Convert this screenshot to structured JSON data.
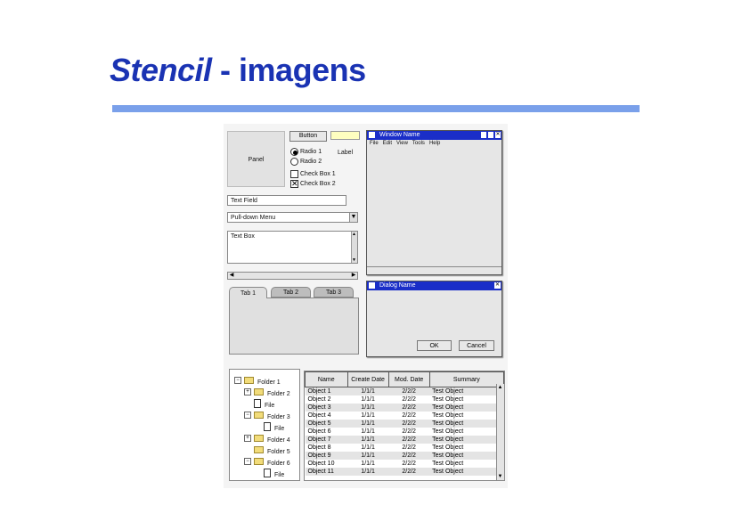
{
  "title": {
    "italic": "Stencil",
    "rest": " - imagens"
  },
  "panel": {
    "label": "Panel"
  },
  "button": {
    "label": "Button"
  },
  "radios": [
    {
      "label": "Radio 1",
      "checked": true
    },
    {
      "label": "Radio 2",
      "checked": false
    }
  ],
  "label_text": "Label",
  "checkboxes": [
    {
      "label": "Check Box 1",
      "checked": false
    },
    {
      "label": "Check Box 2",
      "checked": true
    }
  ],
  "text_field": "Text Field",
  "pulldown": "Pull-down Menu",
  "text_box": "Text Box",
  "tabs": [
    "Tab 1",
    "Tab 2",
    "Tab 3"
  ],
  "window": {
    "title": "Window Name",
    "menu": [
      "File",
      "Edit",
      "View",
      "Tools",
      "Help"
    ]
  },
  "dialog": {
    "title": "Dialog Name",
    "ok": "OK",
    "cancel": "Cancel"
  },
  "tree": [
    "Folder 1",
    "Folder 2",
    "File",
    "Folder 3",
    "File",
    "Folder 4",
    "Folder 5",
    "Folder 6",
    "File"
  ],
  "table": {
    "columns": [
      "Name",
      "Create Date",
      "Mod. Date",
      "Summary"
    ],
    "rows": [
      [
        "Object 1",
        "1/1/1",
        "2/2/2",
        "Test Object"
      ],
      [
        "Object 2",
        "1/1/1",
        "2/2/2",
        "Test Object"
      ],
      [
        "Object 3",
        "1/1/1",
        "2/2/2",
        "Test Object"
      ],
      [
        "Object 4",
        "1/1/1",
        "2/2/2",
        "Test Object"
      ],
      [
        "Object 5",
        "1/1/1",
        "2/2/2",
        "Test Object"
      ],
      [
        "Object 6",
        "1/1/1",
        "2/2/2",
        "Test Object"
      ],
      [
        "Object 7",
        "1/1/1",
        "2/2/2",
        "Test Object"
      ],
      [
        "Object 8",
        "1/1/1",
        "2/2/2",
        "Test Object"
      ],
      [
        "Object 9",
        "1/1/1",
        "2/2/2",
        "Test Object"
      ],
      [
        "Object 10",
        "1/1/1",
        "2/2/2",
        "Test Object"
      ],
      [
        "Object 11",
        "1/1/1",
        "2/2/2",
        "Test Object"
      ]
    ]
  },
  "colors": {
    "title": "#1a33b3",
    "rule": "#7aa0ea",
    "titlebar": "#1a2ec8"
  }
}
